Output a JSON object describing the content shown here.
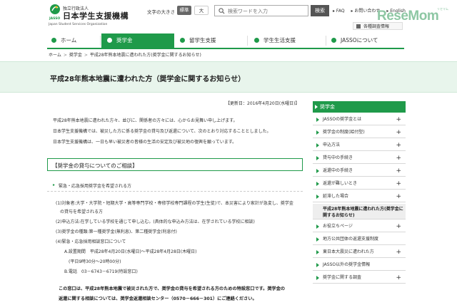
{
  "header": {
    "org_sub": "独立行政法人",
    "org_name": "日本学生支援機構",
    "org_eng": "Japan Student Services Organization",
    "logo_mark": "JASSO",
    "fontsize_label": "文字の大きさ",
    "fontsize_standard": "標準",
    "fontsize_large": "大",
    "search_placeholder": "検索ワードを入力",
    "search_button": "検索",
    "util_faq": "▸ FAQ",
    "util_contact": "▸ お問い合わせ",
    "util_english": "▸ English",
    "survey_link": "各種調査情報",
    "watermark": "ReseMom",
    "watermark_sub": "リセマム"
  },
  "nav": {
    "items": [
      {
        "label": "ホーム",
        "active": false
      },
      {
        "label": "奨学金",
        "active": true
      },
      {
        "label": "留学生支援",
        "active": false
      },
      {
        "label": "学生生活支援",
        "active": false
      },
      {
        "label": "JASSOについて",
        "active": false
      }
    ]
  },
  "breadcrumb": {
    "home": "ホーム",
    "level1": "奨学金",
    "current": "平成28年熊本地震に遭われた方(奨学金に関するお知らせ)"
  },
  "page": {
    "title": "平成28年熊本地震に遭われた方（奨学金に関するお知らせ）",
    "updated": "【更新日：2016年4月20日(水曜日)】",
    "intro": [
      "平成28年熊本地震に遭われた方々、並びに、関係者の方々には、心からお見舞い申し上げます。",
      "日本学生支援機構では、被災した方に係る奨学金の貸与及び返還について、次のとおり対応することとしました。",
      "日本学生支援機構は、一日も早い被災者の皆様の生活の安定及び被災地の復興を願っています。"
    ],
    "section_title": "【奨学金の貸与についてのご相談】",
    "sub_heading": "緊急・応急採用奨学金を希望される方",
    "details": [
      "(1)対象者:大学・大学院・短期大学・高等専門学校・専修学校専門課程の学生(生徒)で、本災害により家計が急変し、奨学金",
      "の貸与を希望される方",
      "(2)申込方法:在学している学校を通じて申し込む。(具体的な申込み方法は、在学されている学校に相談)",
      "(3)奨学金の種類:第一種奨学金(無利息)、第二種奨学金(利息付)",
      "(4)緊急・応急採用相談窓口について",
      "A.設置期間　平成28年4月20日(水曜日)～平成28年4月28日(木曜日)",
      "(平日9時30分～20時00分)",
      "B.電話　03－6743－6719(特設窓口)"
    ],
    "notice": [
      "この窓口は、平成28年熊本地震で被災された方で、奨学金の貸与を希望される方のための特設窓口です。奨学金の",
      "返還に関する相談については、奨学金返還相談センター（0570－666－301）にご連絡ください。"
    ]
  },
  "sidebar": {
    "heading": "奨学金",
    "items": [
      {
        "label": "JASSOの奨学金とは",
        "current": false
      },
      {
        "label": "奨学金の制度(給付型)",
        "current": false
      },
      {
        "label": "申込方法",
        "current": false
      },
      {
        "label": "貸与中の手続き",
        "current": false
      },
      {
        "label": "返還中の手続き",
        "current": false
      },
      {
        "label": "返還が難しいとき",
        "current": false
      },
      {
        "label": "延滞した場合",
        "current": false
      },
      {
        "label": "平成28年熊本地震に遭われた方(奨学金に関するお知らせ)",
        "current": true
      },
      {
        "label": "お役立ちページ",
        "current": false
      },
      {
        "label": "地方公共団体の返還支援制度",
        "current": false
      },
      {
        "label": "東日本大震災に遭われた方",
        "current": false
      },
      {
        "label": "JASSO以外の奨学金情報",
        "current": false
      },
      {
        "label": "奨学金に関する調査",
        "current": false
      }
    ]
  },
  "colors": {
    "brand_green": "#1f9a4a",
    "title_band": "#e8f5ec"
  }
}
